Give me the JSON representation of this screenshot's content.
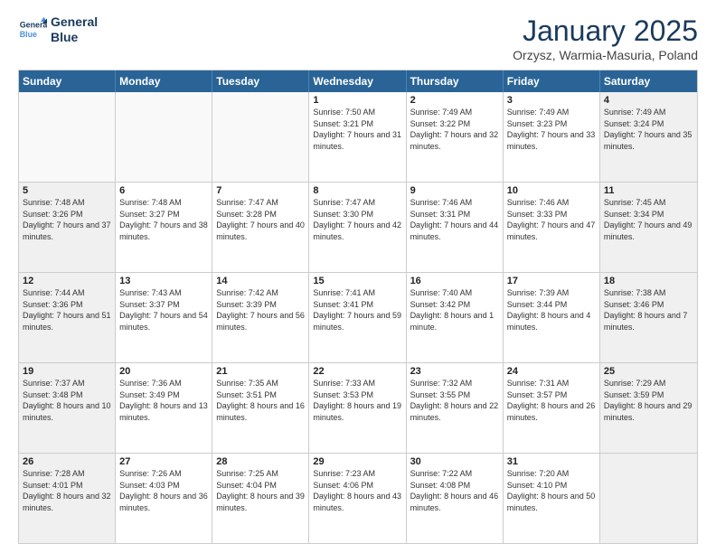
{
  "header": {
    "logo_line1": "General",
    "logo_line2": "Blue",
    "month_title": "January 2025",
    "subtitle": "Orzysz, Warmia-Masuria, Poland"
  },
  "calendar": {
    "days_of_week": [
      "Sunday",
      "Monday",
      "Tuesday",
      "Wednesday",
      "Thursday",
      "Friday",
      "Saturday"
    ],
    "rows": [
      [
        {
          "day": "",
          "sunrise": "",
          "sunset": "",
          "daylight": "",
          "shaded": false,
          "empty": true
        },
        {
          "day": "",
          "sunrise": "",
          "sunset": "",
          "daylight": "",
          "shaded": false,
          "empty": true
        },
        {
          "day": "",
          "sunrise": "",
          "sunset": "",
          "daylight": "",
          "shaded": false,
          "empty": true
        },
        {
          "day": "1",
          "sunrise": "Sunrise: 7:50 AM",
          "sunset": "Sunset: 3:21 PM",
          "daylight": "Daylight: 7 hours and 31 minutes.",
          "shaded": false,
          "empty": false
        },
        {
          "day": "2",
          "sunrise": "Sunrise: 7:49 AM",
          "sunset": "Sunset: 3:22 PM",
          "daylight": "Daylight: 7 hours and 32 minutes.",
          "shaded": false,
          "empty": false
        },
        {
          "day": "3",
          "sunrise": "Sunrise: 7:49 AM",
          "sunset": "Sunset: 3:23 PM",
          "daylight": "Daylight: 7 hours and 33 minutes.",
          "shaded": false,
          "empty": false
        },
        {
          "day": "4",
          "sunrise": "Sunrise: 7:49 AM",
          "sunset": "Sunset: 3:24 PM",
          "daylight": "Daylight: 7 hours and 35 minutes.",
          "shaded": true,
          "empty": false
        }
      ],
      [
        {
          "day": "5",
          "sunrise": "Sunrise: 7:48 AM",
          "sunset": "Sunset: 3:26 PM",
          "daylight": "Daylight: 7 hours and 37 minutes.",
          "shaded": true,
          "empty": false
        },
        {
          "day": "6",
          "sunrise": "Sunrise: 7:48 AM",
          "sunset": "Sunset: 3:27 PM",
          "daylight": "Daylight: 7 hours and 38 minutes.",
          "shaded": false,
          "empty": false
        },
        {
          "day": "7",
          "sunrise": "Sunrise: 7:47 AM",
          "sunset": "Sunset: 3:28 PM",
          "daylight": "Daylight: 7 hours and 40 minutes.",
          "shaded": false,
          "empty": false
        },
        {
          "day": "8",
          "sunrise": "Sunrise: 7:47 AM",
          "sunset": "Sunset: 3:30 PM",
          "daylight": "Daylight: 7 hours and 42 minutes.",
          "shaded": false,
          "empty": false
        },
        {
          "day": "9",
          "sunrise": "Sunrise: 7:46 AM",
          "sunset": "Sunset: 3:31 PM",
          "daylight": "Daylight: 7 hours and 44 minutes.",
          "shaded": false,
          "empty": false
        },
        {
          "day": "10",
          "sunrise": "Sunrise: 7:46 AM",
          "sunset": "Sunset: 3:33 PM",
          "daylight": "Daylight: 7 hours and 47 minutes.",
          "shaded": false,
          "empty": false
        },
        {
          "day": "11",
          "sunrise": "Sunrise: 7:45 AM",
          "sunset": "Sunset: 3:34 PM",
          "daylight": "Daylight: 7 hours and 49 minutes.",
          "shaded": true,
          "empty": false
        }
      ],
      [
        {
          "day": "12",
          "sunrise": "Sunrise: 7:44 AM",
          "sunset": "Sunset: 3:36 PM",
          "daylight": "Daylight: 7 hours and 51 minutes.",
          "shaded": true,
          "empty": false
        },
        {
          "day": "13",
          "sunrise": "Sunrise: 7:43 AM",
          "sunset": "Sunset: 3:37 PM",
          "daylight": "Daylight: 7 hours and 54 minutes.",
          "shaded": false,
          "empty": false
        },
        {
          "day": "14",
          "sunrise": "Sunrise: 7:42 AM",
          "sunset": "Sunset: 3:39 PM",
          "daylight": "Daylight: 7 hours and 56 minutes.",
          "shaded": false,
          "empty": false
        },
        {
          "day": "15",
          "sunrise": "Sunrise: 7:41 AM",
          "sunset": "Sunset: 3:41 PM",
          "daylight": "Daylight: 7 hours and 59 minutes.",
          "shaded": false,
          "empty": false
        },
        {
          "day": "16",
          "sunrise": "Sunrise: 7:40 AM",
          "sunset": "Sunset: 3:42 PM",
          "daylight": "Daylight: 8 hours and 1 minute.",
          "shaded": false,
          "empty": false
        },
        {
          "day": "17",
          "sunrise": "Sunrise: 7:39 AM",
          "sunset": "Sunset: 3:44 PM",
          "daylight": "Daylight: 8 hours and 4 minutes.",
          "shaded": false,
          "empty": false
        },
        {
          "day": "18",
          "sunrise": "Sunrise: 7:38 AM",
          "sunset": "Sunset: 3:46 PM",
          "daylight": "Daylight: 8 hours and 7 minutes.",
          "shaded": true,
          "empty": false
        }
      ],
      [
        {
          "day": "19",
          "sunrise": "Sunrise: 7:37 AM",
          "sunset": "Sunset: 3:48 PM",
          "daylight": "Daylight: 8 hours and 10 minutes.",
          "shaded": true,
          "empty": false
        },
        {
          "day": "20",
          "sunrise": "Sunrise: 7:36 AM",
          "sunset": "Sunset: 3:49 PM",
          "daylight": "Daylight: 8 hours and 13 minutes.",
          "shaded": false,
          "empty": false
        },
        {
          "day": "21",
          "sunrise": "Sunrise: 7:35 AM",
          "sunset": "Sunset: 3:51 PM",
          "daylight": "Daylight: 8 hours and 16 minutes.",
          "shaded": false,
          "empty": false
        },
        {
          "day": "22",
          "sunrise": "Sunrise: 7:33 AM",
          "sunset": "Sunset: 3:53 PM",
          "daylight": "Daylight: 8 hours and 19 minutes.",
          "shaded": false,
          "empty": false
        },
        {
          "day": "23",
          "sunrise": "Sunrise: 7:32 AM",
          "sunset": "Sunset: 3:55 PM",
          "daylight": "Daylight: 8 hours and 22 minutes.",
          "shaded": false,
          "empty": false
        },
        {
          "day": "24",
          "sunrise": "Sunrise: 7:31 AM",
          "sunset": "Sunset: 3:57 PM",
          "daylight": "Daylight: 8 hours and 26 minutes.",
          "shaded": false,
          "empty": false
        },
        {
          "day": "25",
          "sunrise": "Sunrise: 7:29 AM",
          "sunset": "Sunset: 3:59 PM",
          "daylight": "Daylight: 8 hours and 29 minutes.",
          "shaded": true,
          "empty": false
        }
      ],
      [
        {
          "day": "26",
          "sunrise": "Sunrise: 7:28 AM",
          "sunset": "Sunset: 4:01 PM",
          "daylight": "Daylight: 8 hours and 32 minutes.",
          "shaded": true,
          "empty": false
        },
        {
          "day": "27",
          "sunrise": "Sunrise: 7:26 AM",
          "sunset": "Sunset: 4:03 PM",
          "daylight": "Daylight: 8 hours and 36 minutes.",
          "shaded": false,
          "empty": false
        },
        {
          "day": "28",
          "sunrise": "Sunrise: 7:25 AM",
          "sunset": "Sunset: 4:04 PM",
          "daylight": "Daylight: 8 hours and 39 minutes.",
          "shaded": false,
          "empty": false
        },
        {
          "day": "29",
          "sunrise": "Sunrise: 7:23 AM",
          "sunset": "Sunset: 4:06 PM",
          "daylight": "Daylight: 8 hours and 43 minutes.",
          "shaded": false,
          "empty": false
        },
        {
          "day": "30",
          "sunrise": "Sunrise: 7:22 AM",
          "sunset": "Sunset: 4:08 PM",
          "daylight": "Daylight: 8 hours and 46 minutes.",
          "shaded": false,
          "empty": false
        },
        {
          "day": "31",
          "sunrise": "Sunrise: 7:20 AM",
          "sunset": "Sunset: 4:10 PM",
          "daylight": "Daylight: 8 hours and 50 minutes.",
          "shaded": false,
          "empty": false
        },
        {
          "day": "",
          "sunrise": "",
          "sunset": "",
          "daylight": "",
          "shaded": true,
          "empty": true
        }
      ]
    ]
  }
}
